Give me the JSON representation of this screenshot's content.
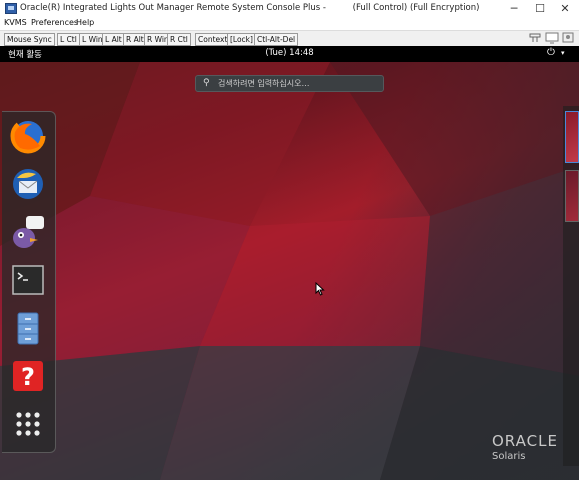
{
  "window": {
    "title": "Oracle(R) Integrated Lights Out Manager Remote System Console Plus -",
    "mode": "(Full Control) (Full Encryption)",
    "controls": {
      "minimize": "─",
      "maximize": "☐",
      "close": "✕"
    }
  },
  "menu": {
    "items": [
      "KVMS",
      "Preferences",
      "Help"
    ]
  },
  "toolbar": {
    "buttons": [
      "Mouse Sync",
      "L Ctl",
      "L Win",
      "L Alt",
      "R Alt",
      "R Win",
      "R Ctl",
      "Context",
      "[Lock]",
      "Ctl-Alt-Del"
    ],
    "right_icons": [
      "keyboard-icon",
      "monitor-icon",
      "display-icon"
    ]
  },
  "gnome": {
    "activities": "현재 활동",
    "clock": "(Tue) 14:48",
    "power_icon": "power-icon",
    "search_placeholder": "검색하려면 입력하십시오…"
  },
  "dash": {
    "apps": [
      "firefox-icon",
      "thunderbird-icon",
      "pidgin-icon",
      "terminal-icon",
      "file-manager-icon",
      "help-icon",
      "show-apps-icon"
    ]
  },
  "branding": {
    "name": "ORACLE",
    "product": "Solaris"
  },
  "colors": {
    "accent": "#4a88d8",
    "topbar": "#000000",
    "wallpaper_red": "#a31d2a"
  }
}
